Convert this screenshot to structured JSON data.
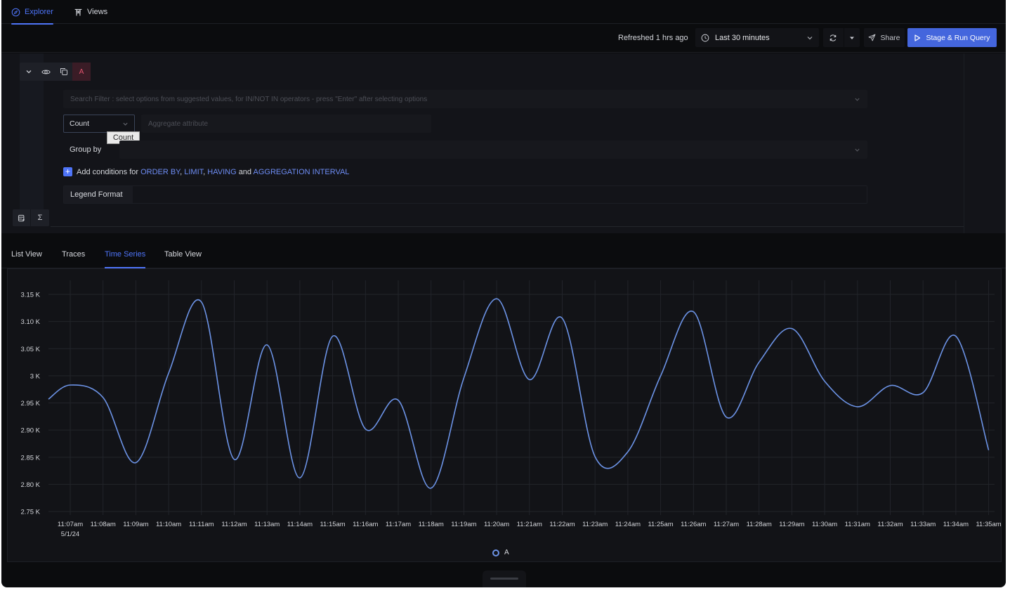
{
  "nav": {
    "tabs": [
      {
        "label": "Explorer",
        "icon": "compass-icon",
        "active": true
      },
      {
        "label": "Views",
        "icon": "torii-icon",
        "active": false
      }
    ]
  },
  "toolbar": {
    "refreshed_text": "Refreshed 1 hrs ago",
    "time_range": "Last 30 minutes",
    "share_label": "Share",
    "run_label": "Stage & Run Query",
    "accent_color": "#4466dd"
  },
  "query": {
    "name": "A",
    "search_placeholder": "Search Filter : select options from suggested values, for IN/NOT IN operators - press \"Enter\" after selecting options",
    "aggregate_operator": "Count",
    "aggregate_tooltip": "Count",
    "aggregate_attribute_placeholder": "Aggregate attribute",
    "group_by_label": "Group by",
    "add_conditions": {
      "prefix": "Add conditions for",
      "order_by": "ORDER BY",
      "limit": "LIMIT",
      "having": "HAVING",
      "and": "and",
      "aggregation_interval": "AGGREGATION INTERVAL"
    },
    "legend_format_label": "Legend Format",
    "legend_format_value": ""
  },
  "right_panel": {
    "query_badge": "A"
  },
  "view_tabs": [
    {
      "label": "List View",
      "active": false
    },
    {
      "label": "Traces",
      "active": false
    },
    {
      "label": "Time Series",
      "active": true
    },
    {
      "label": "Table View",
      "active": false
    }
  ],
  "chart_data": {
    "type": "line",
    "title": "",
    "xlabel": "",
    "ylabel": "",
    "date_label": "5/1/24",
    "ylim": [
      2.75,
      3.15
    ],
    "y_unit": "K",
    "y_ticks": [
      "3.15 K",
      "3.10 K",
      "3.05 K",
      "3 K",
      "2.95 K",
      "2.90 K",
      "2.85 K",
      "2.80 K",
      "2.75 K"
    ],
    "y_tick_values": [
      3.15,
      3.1,
      3.05,
      3.0,
      2.95,
      2.9,
      2.85,
      2.8,
      2.75
    ],
    "x": [
      "11:07am",
      "11:08am",
      "11:09am",
      "11:10am",
      "11:11am",
      "11:12am",
      "11:13am",
      "11:14am",
      "11:15am",
      "11:16am",
      "11:17am",
      "11:18am",
      "11:19am",
      "11:20am",
      "11:21am",
      "11:22am",
      "11:23am",
      "11:24am",
      "11:25am",
      "11:26am",
      "11:27am",
      "11:28am",
      "11:29am",
      "11:30am",
      "11:31am",
      "11:32am",
      "11:33am",
      "11:34am",
      "11:35am"
    ],
    "start_value": 2.957,
    "series": [
      {
        "name": "A",
        "color": "#6c93e6",
        "values": [
          2.983,
          2.96,
          2.84,
          3.005,
          3.136,
          2.846,
          3.057,
          2.812,
          3.073,
          2.902,
          2.955,
          2.793,
          2.996,
          3.142,
          2.993,
          3.106,
          2.851,
          2.86,
          3.0,
          3.118,
          2.924,
          3.025,
          3.087,
          2.99,
          2.943,
          2.982,
          2.969,
          3.073,
          2.863
        ]
      }
    ],
    "grid": true,
    "legend": "bottom-center"
  }
}
